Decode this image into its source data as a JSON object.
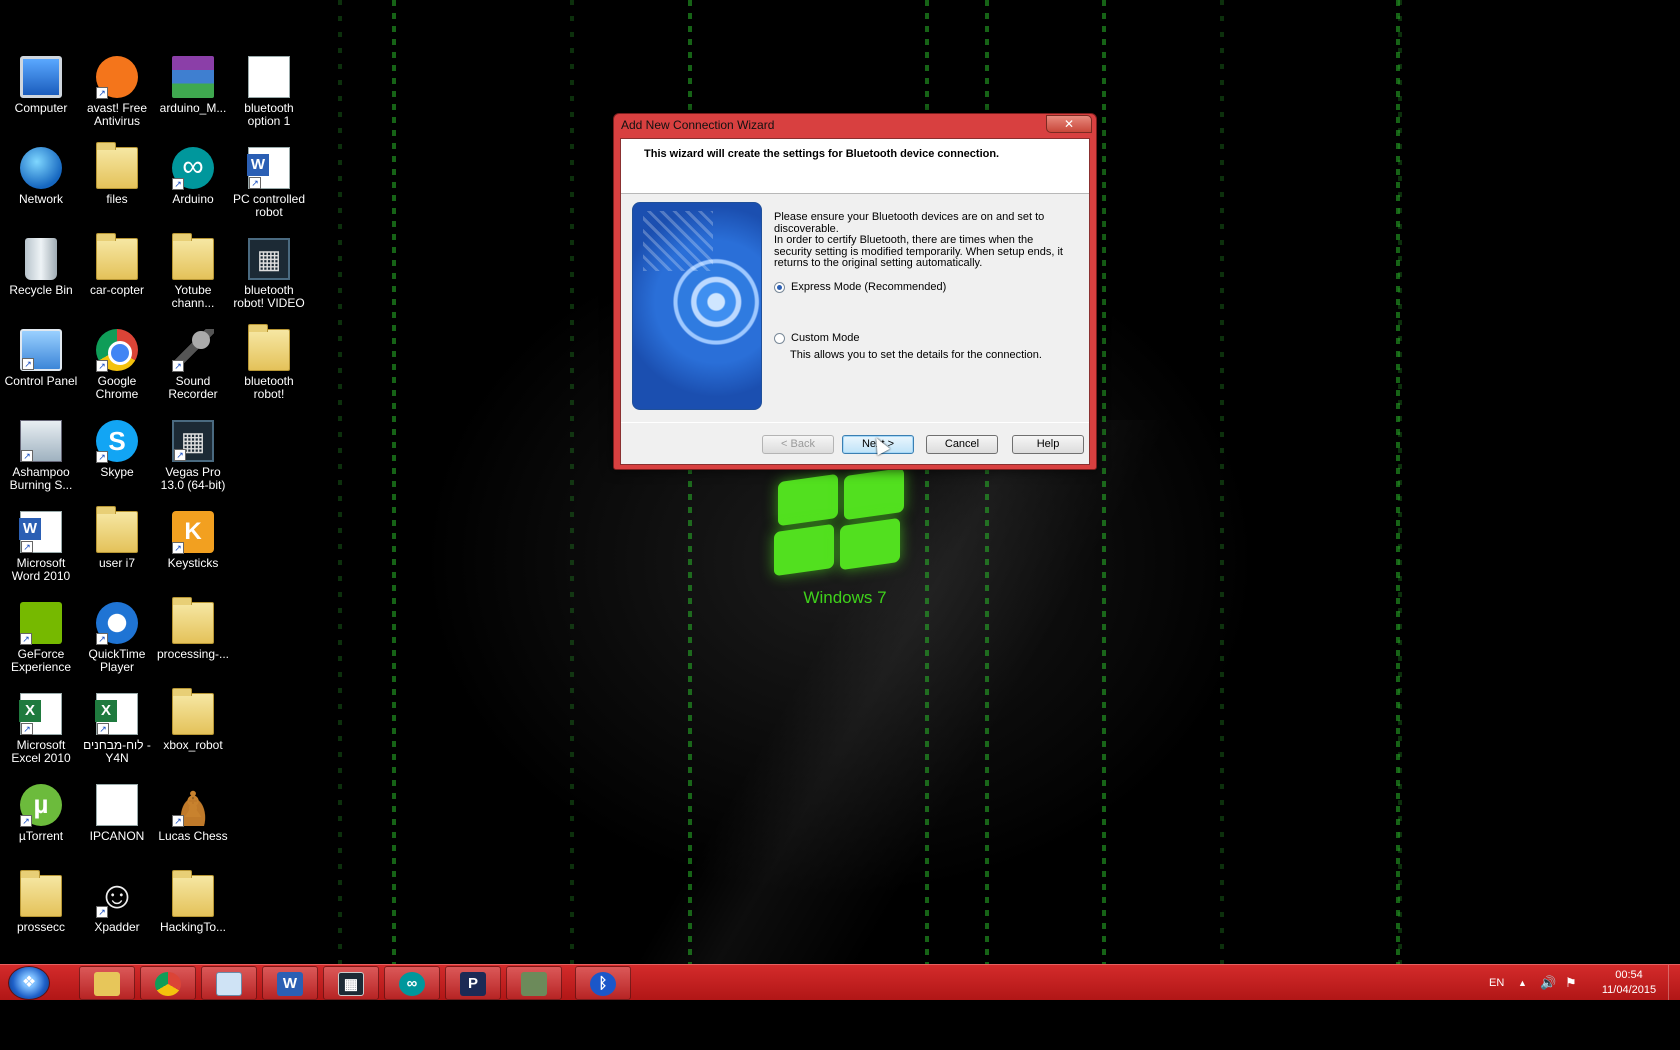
{
  "desktop": {
    "background_text": "Windows 7",
    "icons": [
      {
        "label": "Computer",
        "icon": "computer-icon"
      },
      {
        "label": "avast! Free Antivirus",
        "icon": "avast-icon"
      },
      {
        "label": "arduino_M...",
        "icon": "winrar-archive-icon"
      },
      {
        "label": "bluetooth option 1",
        "icon": "document-icon"
      },
      {
        "label": "Network",
        "icon": "network-icon"
      },
      {
        "label": "files",
        "icon": "folder-icon"
      },
      {
        "label": "Arduino",
        "icon": "arduino-icon"
      },
      {
        "label": "PC controlled robot",
        "icon": "word-document-icon"
      },
      {
        "label": "Recycle Bin",
        "icon": "recycle-bin-icon"
      },
      {
        "label": "car-copter",
        "icon": "folder-icon"
      },
      {
        "label": "Yotube chann...",
        "icon": "folder-icon"
      },
      {
        "label": "bluetooth robot! VIDEO",
        "icon": "video-file-icon"
      },
      {
        "label": "Control Panel",
        "icon": "control-panel-icon"
      },
      {
        "label": "Google Chrome",
        "icon": "chrome-icon"
      },
      {
        "label": "Sound Recorder",
        "icon": "microphone-icon"
      },
      {
        "label": "bluetooth robot!",
        "icon": "folder-icon"
      },
      {
        "label": "Ashampoo Burning S...",
        "icon": "ashampoo-icon"
      },
      {
        "label": "Skype",
        "icon": "skype-icon"
      },
      {
        "label": "Vegas Pro 13.0 (64-bit)",
        "icon": "vegas-icon"
      },
      {
        "label": "Microsoft Word 2010",
        "icon": "word-icon"
      },
      {
        "label": "user i7",
        "icon": "user-folder-icon"
      },
      {
        "label": "Keysticks",
        "icon": "keysticks-icon"
      },
      {
        "label": "GeForce Experience",
        "icon": "nvidia-icon"
      },
      {
        "label": "QuickTime Player",
        "icon": "quicktime-icon"
      },
      {
        "label": "processing-...",
        "icon": "folder-icon"
      },
      {
        "label": "Microsoft Excel 2010",
        "icon": "excel-icon"
      },
      {
        "label": "לוח-מבחנים -Y4N",
        "icon": "excel-document-icon"
      },
      {
        "label": "xbox_robot",
        "icon": "folder-icon"
      },
      {
        "label": "µTorrent",
        "icon": "utorrent-icon"
      },
      {
        "label": "IPCANON",
        "icon": "document-icon"
      },
      {
        "label": "Lucas Chess",
        "icon": "chess-icon"
      },
      {
        "label": "prossecc",
        "icon": "folder-icon"
      },
      {
        "label": "Xpadder",
        "icon": "gamepad-icon"
      },
      {
        "label": "HackingTo...",
        "icon": "folder-icon"
      }
    ]
  },
  "dialog": {
    "title": "Add New Connection Wizard",
    "close_label": "✕",
    "header": "This wizard will create the settings for Bluetooth device connection.",
    "description_1": "Please ensure your Bluetooth devices are on and set to discoverable.",
    "description_2": "In order to certify Bluetooth, there are times when the security setting is modified temporarily. When setup ends, it returns to the original setting automatically.",
    "express_mode_label": "Express Mode (Recommended)",
    "express_mode_selected": true,
    "custom_mode_label": "Custom Mode",
    "custom_mode_selected": false,
    "custom_mode_description": "This allows you to set the details for the connection.",
    "back_label": "< Back",
    "next_label": "Next >",
    "cancel_label": "Cancel",
    "help_label": "Help"
  },
  "taskbar": {
    "pinned": [
      {
        "name": "windows-explorer",
        "icon": "folder-icon"
      },
      {
        "name": "google-chrome",
        "icon": "chrome-icon"
      },
      {
        "name": "virtualbox",
        "icon": "cube-icon"
      },
      {
        "name": "microsoft-word",
        "icon": "word-icon"
      },
      {
        "name": "vegas-pro",
        "icon": "vegas-icon"
      },
      {
        "name": "arduino",
        "icon": "arduino-icon"
      },
      {
        "name": "processing",
        "icon": "processing-icon"
      },
      {
        "name": "device-app",
        "icon": "device-icon"
      },
      {
        "name": "bluetooth",
        "icon": "bluetooth-icon"
      }
    ],
    "language": "EN",
    "time": "00:54",
    "date": "11/04/2015"
  },
  "colors": {
    "taskbar": "#c41f1f",
    "dialog_frame": "#d84040",
    "accent_green": "#52e01f"
  }
}
